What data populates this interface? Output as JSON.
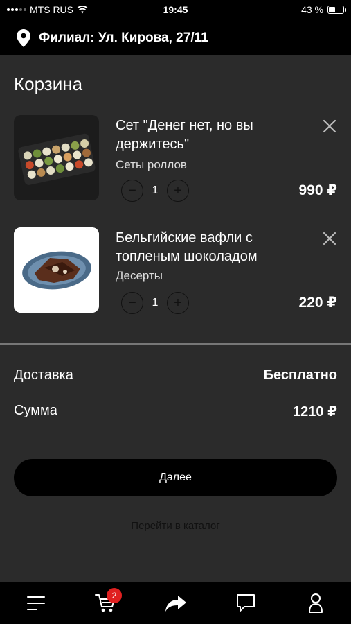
{
  "status_bar": {
    "carrier": "MTS RUS",
    "time": "19:45",
    "battery_percent": "43 %",
    "battery_level": 0.43
  },
  "branch": {
    "label": "Филиал: Ул. Кирова, 27/11",
    "icon": "location-pin-icon"
  },
  "cart": {
    "title": "Корзина",
    "items": [
      {
        "name": "Сет \"Денег нет, но вы держитесь\"",
        "category": "Сеты роллов",
        "quantity": "1",
        "price": "990 ₽"
      },
      {
        "name": "Бельгийские вафли с топленым шоколадом",
        "category": "Десерты",
        "quantity": "1",
        "price": "220 ₽"
      }
    ]
  },
  "summary": {
    "delivery_label": "Доставка",
    "delivery_value": "Бесплатно",
    "total_label": "Сумма",
    "total_value": "1210 ₽"
  },
  "actions": {
    "next_label": "Далее",
    "catalog_link": "Перейти в каталог"
  },
  "tab_bar": {
    "items": [
      "menu-icon",
      "cart-icon",
      "share-icon",
      "chat-icon",
      "profile-icon"
    ],
    "cart_badge": "2"
  },
  "colors": {
    "background": "#2b2b2b",
    "bars": "#000000",
    "badge": "#e02020"
  }
}
